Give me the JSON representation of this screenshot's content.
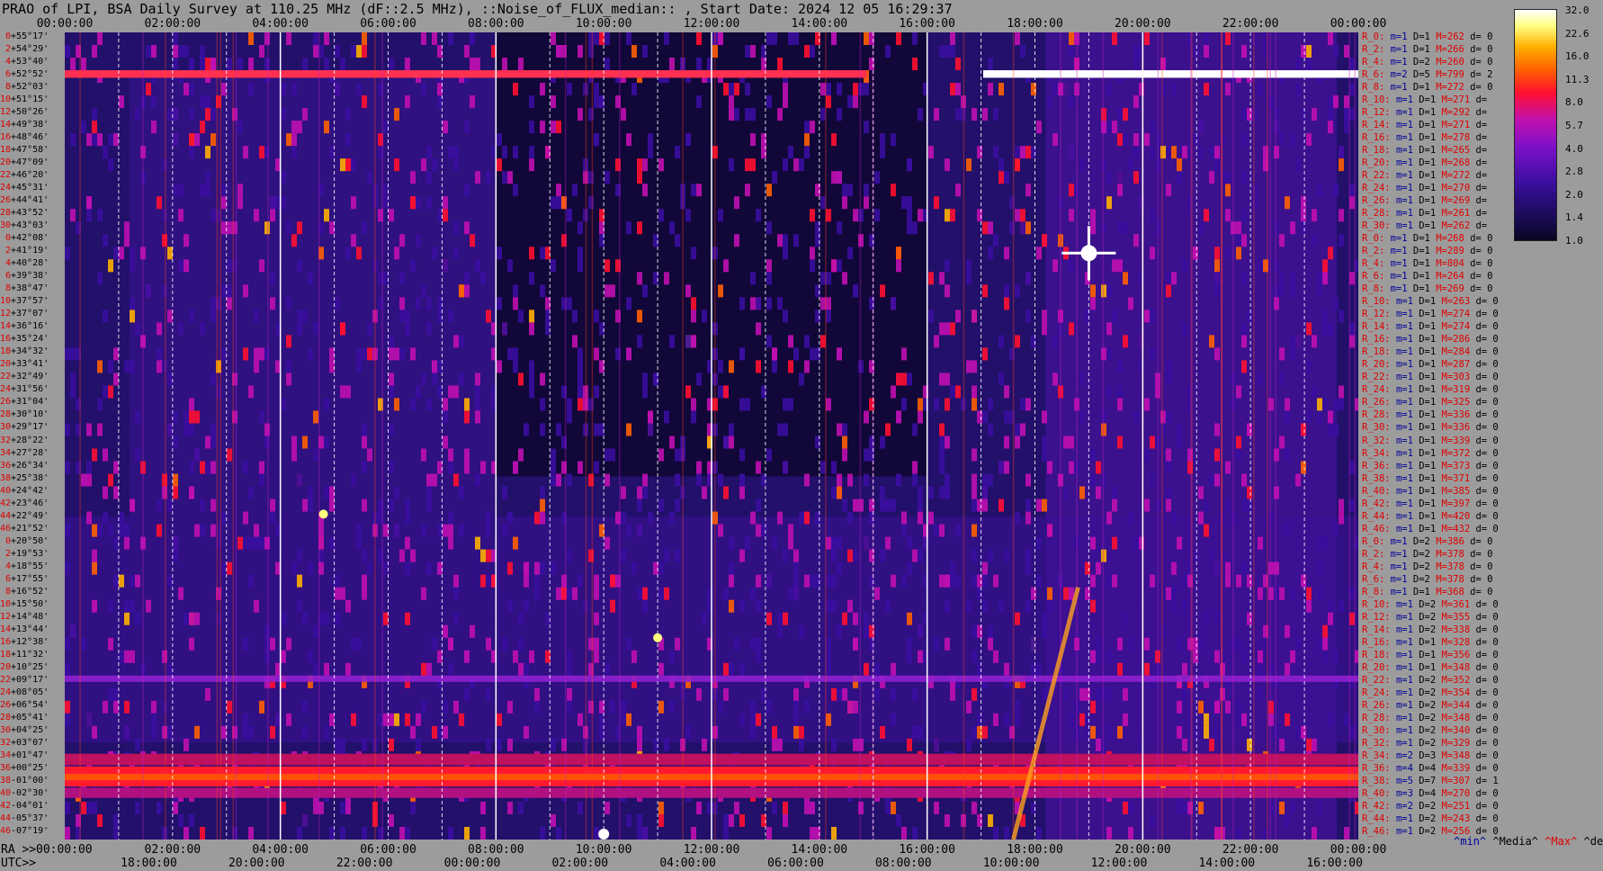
{
  "title": "PRAO of LPI, BSA Daily Survey at 110.25 MHz (dF::2.5 MHz), ::Noise_of_FLUX_median:: , Start Date: 2024 12 05 16:29:37",
  "chart_data": {
    "type": "heatmap",
    "top_axis_ticks": [
      "00:00:00",
      "02:00:00",
      "04:00:00",
      "06:00:00",
      "08:00:00",
      "10:00:00",
      "12:00:00",
      "14:00:00",
      "16:00:00",
      "18:00:00",
      "20:00:00",
      "22:00:00",
      "00:00:00"
    ],
    "ra_prefix": "RA >>",
    "ra_ticks": [
      "00:00:00",
      "02:00:00",
      "04:00:00",
      "06:00:00",
      "08:00:00",
      "10:00:00",
      "12:00:00",
      "14:00:00",
      "16:00:00",
      "18:00:00",
      "20:00:00",
      "22:00:00",
      "00:00:00"
    ],
    "utc_prefix": "UTC>>",
    "utc_ticks": [
      "18:00:00",
      "20:00:00",
      "22:00:00",
      "00:00:00",
      "02:00:00",
      "04:00:00",
      "06:00:00",
      "08:00:00",
      "10:00:00",
      "12:00:00",
      "14:00:00",
      "16:00:00"
    ],
    "colorbar_ticks": [
      "32.0",
      "22.6",
      "16.0",
      "11.3",
      "8.0",
      "5.7",
      "4.0",
      "2.8",
      "2.0",
      "1.4",
      "1.0"
    ],
    "colormap": [
      "#0a0520",
      "#3a0e9e",
      "#c010b0",
      "#ff1030",
      "#ff6000",
      "#ffb000",
      "#ffffff"
    ],
    "legend": [
      "^min^",
      "^Media^",
      "^Max^",
      "^devia^"
    ],
    "declinations": [
      {
        "i": "0",
        "d": "+55°17'"
      },
      {
        "i": "2",
        "d": "+54°29'"
      },
      {
        "i": "4",
        "d": "+53°40'"
      },
      {
        "i": "6",
        "d": "+52°52'"
      },
      {
        "i": "8",
        "d": "+52°03'"
      },
      {
        "i": "10",
        "d": "+51°15'"
      },
      {
        "i": "12",
        "d": "+50°26'"
      },
      {
        "i": "14",
        "d": "+49°38'"
      },
      {
        "i": "16",
        "d": "+48°46'"
      },
      {
        "i": "18",
        "d": "+47°58'"
      },
      {
        "i": "20",
        "d": "+47°09'"
      },
      {
        "i": "22",
        "d": "+46°20'"
      },
      {
        "i": "24",
        "d": "+45°31'"
      },
      {
        "i": "26",
        "d": "+44°41'"
      },
      {
        "i": "28",
        "d": "+43°52'"
      },
      {
        "i": "30",
        "d": "+43°03'"
      },
      {
        "i": "0",
        "d": "+42°08'"
      },
      {
        "i": "2",
        "d": "+41°19'"
      },
      {
        "i": "4",
        "d": "+40°28'"
      },
      {
        "i": "6",
        "d": "+39°38'"
      },
      {
        "i": "8",
        "d": "+38°47'"
      },
      {
        "i": "10",
        "d": "+37°57'"
      },
      {
        "i": "12",
        "d": "+37°07'"
      },
      {
        "i": "14",
        "d": "+36°16'"
      },
      {
        "i": "16",
        "d": "+35°24'"
      },
      {
        "i": "18",
        "d": "+34°32'"
      },
      {
        "i": "20",
        "d": "+33°41'"
      },
      {
        "i": "22",
        "d": "+32°49'"
      },
      {
        "i": "24",
        "d": "+31°56'"
      },
      {
        "i": "26",
        "d": "+31°04'"
      },
      {
        "i": "28",
        "d": "+30°10'"
      },
      {
        "i": "30",
        "d": "+29°17'"
      },
      {
        "i": "32",
        "d": "+28°22'"
      },
      {
        "i": "34",
        "d": "+27°28'"
      },
      {
        "i": "36",
        "d": "+26°34'"
      },
      {
        "i": "38",
        "d": "+25°38'"
      },
      {
        "i": "40",
        "d": "+24°42'"
      },
      {
        "i": "42",
        "d": "+23°46'"
      },
      {
        "i": "44",
        "d": "+22°49'"
      },
      {
        "i": "46",
        "d": "+21°52'"
      },
      {
        "i": "0",
        "d": "+20°50'"
      },
      {
        "i": "2",
        "d": "+19°53'"
      },
      {
        "i": "4",
        "d": "+18°55'"
      },
      {
        "i": "6",
        "d": "+17°55'"
      },
      {
        "i": "8",
        "d": "+16°52'"
      },
      {
        "i": "10",
        "d": "+15°50'"
      },
      {
        "i": "12",
        "d": "+14°48'"
      },
      {
        "i": "14",
        "d": "+13°44'"
      },
      {
        "i": "16",
        "d": "+12°38'"
      },
      {
        "i": "18",
        "d": "+11°32'"
      },
      {
        "i": "20",
        "d": "+10°25'"
      },
      {
        "i": "22",
        "d": "+09°17'"
      },
      {
        "i": "24",
        "d": "+08°05'"
      },
      {
        "i": "26",
        "d": "+06°54'"
      },
      {
        "i": "28",
        "d": "+05°41'"
      },
      {
        "i": "30",
        "d": "+04°25'"
      },
      {
        "i": "32",
        "d": "+03°07'"
      },
      {
        "i": "34",
        "d": "+01°47'"
      },
      {
        "i": "36",
        "d": "+00°25'"
      },
      {
        "i": "38",
        "d": "-01°00'"
      },
      {
        "i": "40",
        "d": "-02°30'"
      },
      {
        "i": "42",
        "d": "-04°01'"
      },
      {
        "i": "44",
        "d": "-05°37'"
      },
      {
        "i": "46",
        "d": "-07°19'"
      }
    ],
    "row_stats": [
      {
        "r": "R_0:",
        "m": "m=1",
        "D": "D=1",
        "M": "M=262",
        "d": "d= 0"
      },
      {
        "r": "R_2:",
        "m": "m=1",
        "D": "D=1",
        "M": "M=266",
        "d": "d= 0"
      },
      {
        "r": "R_4:",
        "m": "m=1",
        "D": "D=2",
        "M": "M=260",
        "d": "d= 0"
      },
      {
        "r": "R_6:",
        "m": "m=2",
        "D": "D=5",
        "M": "M=799",
        "d": "d= 2"
      },
      {
        "r": "R_8:",
        "m": "m=1",
        "D": "D=1",
        "M": "M=272",
        "d": "d= 0"
      },
      {
        "r": "R_10:",
        "m": "m=1",
        "D": "D=1",
        "M": "M=271",
        "d": "d="
      },
      {
        "r": "R_12:",
        "m": "m=1",
        "D": "D=1",
        "M": "M=292",
        "d": "d="
      },
      {
        "r": "R_14:",
        "m": "m=1",
        "D": "D=1",
        "M": "M=271",
        "d": "d="
      },
      {
        "r": "R_16:",
        "m": "m=1",
        "D": "D=1",
        "M": "M=278",
        "d": "d="
      },
      {
        "r": "R_18:",
        "m": "m=1",
        "D": "D=1",
        "M": "M=265",
        "d": "d="
      },
      {
        "r": "R_20:",
        "m": "m=1",
        "D": "D=1",
        "M": "M=268",
        "d": "d="
      },
      {
        "r": "R_22:",
        "m": "m=1",
        "D": "D=1",
        "M": "M=272",
        "d": "d="
      },
      {
        "r": "R_24:",
        "m": "m=1",
        "D": "D=1",
        "M": "M=270",
        "d": "d="
      },
      {
        "r": "R_26:",
        "m": "m=1",
        "D": "D=1",
        "M": "M=269",
        "d": "d="
      },
      {
        "r": "R_28:",
        "m": "m=1",
        "D": "D=1",
        "M": "M=261",
        "d": "d="
      },
      {
        "r": "R_30:",
        "m": "m=1",
        "D": "D=1",
        "M": "M=262",
        "d": "d="
      },
      {
        "r": "R_0:",
        "m": "m=1",
        "D": "D=1",
        "M": "M=268",
        "d": "d= 0"
      },
      {
        "r": "R_2:",
        "m": "m=1",
        "D": "D=1",
        "M": "M=289",
        "d": "d= 0"
      },
      {
        "r": "R_4:",
        "m": "m=1",
        "D": "D=1",
        "M": "M=804",
        "d": "d= 0"
      },
      {
        "r": "R_6:",
        "m": "m=1",
        "D": "D=1",
        "M": "M=264",
        "d": "d= 0"
      },
      {
        "r": "R_8:",
        "m": "m=1",
        "D": "D=1",
        "M": "M=269",
        "d": "d= 0"
      },
      {
        "r": "R_10:",
        "m": "m=1",
        "D": "D=1",
        "M": "M=263",
        "d": "d= 0"
      },
      {
        "r": "R_12:",
        "m": "m=1",
        "D": "D=1",
        "M": "M=274",
        "d": "d= 0"
      },
      {
        "r": "R_14:",
        "m": "m=1",
        "D": "D=1",
        "M": "M=274",
        "d": "d= 0"
      },
      {
        "r": "R_16:",
        "m": "m=1",
        "D": "D=1",
        "M": "M=286",
        "d": "d= 0"
      },
      {
        "r": "R_18:",
        "m": "m=1",
        "D": "D=1",
        "M": "M=284",
        "d": "d= 0"
      },
      {
        "r": "R_20:",
        "m": "m=1",
        "D": "D=1",
        "M": "M=287",
        "d": "d= 0"
      },
      {
        "r": "R_22:",
        "m": "m=1",
        "D": "D=1",
        "M": "M=303",
        "d": "d= 0"
      },
      {
        "r": "R_24:",
        "m": "m=1",
        "D": "D=1",
        "M": "M=319",
        "d": "d= 0"
      },
      {
        "r": "R_26:",
        "m": "m=1",
        "D": "D=1",
        "M": "M=325",
        "d": "d= 0"
      },
      {
        "r": "R_28:",
        "m": "m=1",
        "D": "D=1",
        "M": "M=336",
        "d": "d= 0"
      },
      {
        "r": "R_30:",
        "m": "m=1",
        "D": "D=1",
        "M": "M=336",
        "d": "d= 0"
      },
      {
        "r": "R_32:",
        "m": "m=1",
        "D": "D=1",
        "M": "M=339",
        "d": "d= 0"
      },
      {
        "r": "R_34:",
        "m": "m=1",
        "D": "D=1",
        "M": "M=372",
        "d": "d= 0"
      },
      {
        "r": "R_36:",
        "m": "m=1",
        "D": "D=1",
        "M": "M=373",
        "d": "d= 0"
      },
      {
        "r": "R_38:",
        "m": "m=1",
        "D": "D=1",
        "M": "M=371",
        "d": "d= 0"
      },
      {
        "r": "R_40:",
        "m": "m=1",
        "D": "D=1",
        "M": "M=385",
        "d": "d= 0"
      },
      {
        "r": "R_42:",
        "m": "m=1",
        "D": "D=1",
        "M": "M=397",
        "d": "d= 0"
      },
      {
        "r": "R_44:",
        "m": "m=1",
        "D": "D=1",
        "M": "M=420",
        "d": "d= 0"
      },
      {
        "r": "R_46:",
        "m": "m=1",
        "D": "D=1",
        "M": "M=432",
        "d": "d= 0"
      },
      {
        "r": "R_0:",
        "m": "m=1",
        "D": "D=2",
        "M": "M=386",
        "d": "d= 0"
      },
      {
        "r": "R_2:",
        "m": "m=1",
        "D": "D=2",
        "M": "M=378",
        "d": "d= 0"
      },
      {
        "r": "R_4:",
        "m": "m=1",
        "D": "D=2",
        "M": "M=378",
        "d": "d= 0"
      },
      {
        "r": "R_6:",
        "m": "m=1",
        "D": "D=2",
        "M": "M=378",
        "d": "d= 0"
      },
      {
        "r": "R_8:",
        "m": "m=1",
        "D": "D=1",
        "M": "M=368",
        "d": "d= 0"
      },
      {
        "r": "R_10:",
        "m": "m=1",
        "D": "D=2",
        "M": "M=361",
        "d": "d= 0"
      },
      {
        "r": "R_12:",
        "m": "m=1",
        "D": "D=2",
        "M": "M=355",
        "d": "d= 0"
      },
      {
        "r": "R_14:",
        "m": "m=1",
        "D": "D=2",
        "M": "M=338",
        "d": "d= 0"
      },
      {
        "r": "R_16:",
        "m": "m=1",
        "D": "D=1",
        "M": "M=328",
        "d": "d= 0"
      },
      {
        "r": "R_18:",
        "m": "m=1",
        "D": "D=1",
        "M": "M=356",
        "d": "d= 0"
      },
      {
        "r": "R_20:",
        "m": "m=1",
        "D": "D=1",
        "M": "M=348",
        "d": "d= 0"
      },
      {
        "r": "R_22:",
        "m": "m=1",
        "D": "D=2",
        "M": "M=352",
        "d": "d= 0"
      },
      {
        "r": "R_24:",
        "m": "m=1",
        "D": "D=2",
        "M": "M=354",
        "d": "d= 0"
      },
      {
        "r": "R_26:",
        "m": "m=1",
        "D": "D=2",
        "M": "M=344",
        "d": "d= 0"
      },
      {
        "r": "R_28:",
        "m": "m=1",
        "D": "D=2",
        "M": "M=348",
        "d": "d= 0"
      },
      {
        "r": "R_30:",
        "m": "m=1",
        "D": "D=2",
        "M": "M=340",
        "d": "d= 0"
      },
      {
        "r": "R_32:",
        "m": "m=1",
        "D": "D=2",
        "M": "M=329",
        "d": "d= 0"
      },
      {
        "r": "R_34:",
        "m": "m=2",
        "D": "D=3",
        "M": "M=348",
        "d": "d= 0"
      },
      {
        "r": "R_36:",
        "m": "m=4",
        "D": "D=4",
        "M": "M=339",
        "d": "d= 0"
      },
      {
        "r": "R_38:",
        "m": "m=5",
        "D": "D=7",
        "M": "M=307",
        "d": "d= 1"
      },
      {
        "r": "R_40:",
        "m": "m=3",
        "D": "D=4",
        "M": "M=270",
        "d": "d= 0"
      },
      {
        "r": "R_42:",
        "m": "m=2",
        "D": "D=2",
        "M": "M=251",
        "d": "d= 0"
      },
      {
        "r": "R_44:",
        "m": "m=1",
        "D": "D=2",
        "M": "M=243",
        "d": "d= 0"
      },
      {
        "r": "R_46:",
        "m": "m=1",
        "D": "D=2",
        "M": "M=256",
        "d": "d= 0"
      }
    ]
  }
}
